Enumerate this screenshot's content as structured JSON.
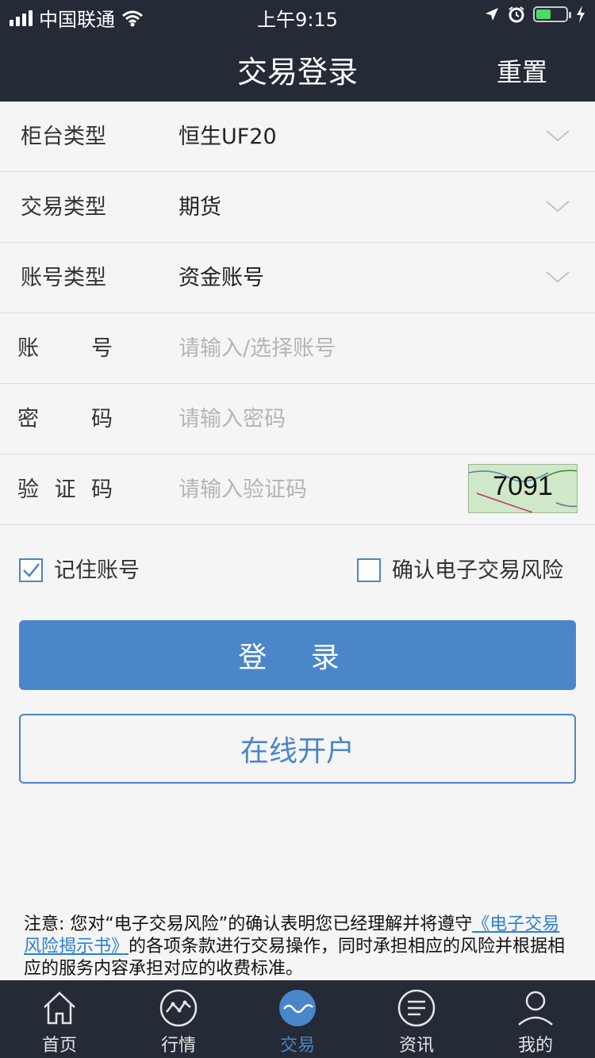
{
  "status_bar": {
    "carrier": "中国联通",
    "time": "上午9:15",
    "battery_level": 0.5
  },
  "header": {
    "title": "交易登录",
    "reset_label": "重置"
  },
  "form": {
    "counter_type": {
      "label": "柜台类型",
      "value": "恒生UF20"
    },
    "trade_type": {
      "label": "交易类型",
      "value": "期货"
    },
    "account_type": {
      "label": "账号类型",
      "value": "资金账号"
    },
    "account": {
      "label_chars": [
        "账",
        "号"
      ],
      "placeholder": "请输入/选择账号"
    },
    "password": {
      "label_chars": [
        "密",
        "码"
      ],
      "placeholder": "请输入密码"
    },
    "captcha": {
      "label_chars": [
        "验",
        "证",
        "码"
      ],
      "placeholder": "请输入验证码",
      "code": "7091"
    }
  },
  "options": {
    "remember_label": "记住账号",
    "remember_checked": true,
    "confirm_risk_label": "确认电子交易风险",
    "confirm_risk_checked": false
  },
  "buttons": {
    "login": "登 录",
    "open_account": "在线开户"
  },
  "notice": {
    "prefix": "注意: 您对“电子交易风险”的确认表明您已经理解并将遵守",
    "link": "《电子交易风险揭示书》",
    "suffix": "的各项条款进行交易操作，同时承担相应的风险并根据相应的服务内容承担对应的收费标准。"
  },
  "tabs": [
    {
      "label": "首页",
      "icon": "home-icon"
    },
    {
      "label": "行情",
      "icon": "chart-icon"
    },
    {
      "label": "交易",
      "icon": "trade-icon",
      "active": true
    },
    {
      "label": "资讯",
      "icon": "news-icon"
    },
    {
      "label": "我的",
      "icon": "user-icon"
    }
  ],
  "colors": {
    "header_bg": "#242a36",
    "accent": "#4a86c8",
    "link": "#2b7fd0",
    "page_bg": "#f5f5f5"
  }
}
